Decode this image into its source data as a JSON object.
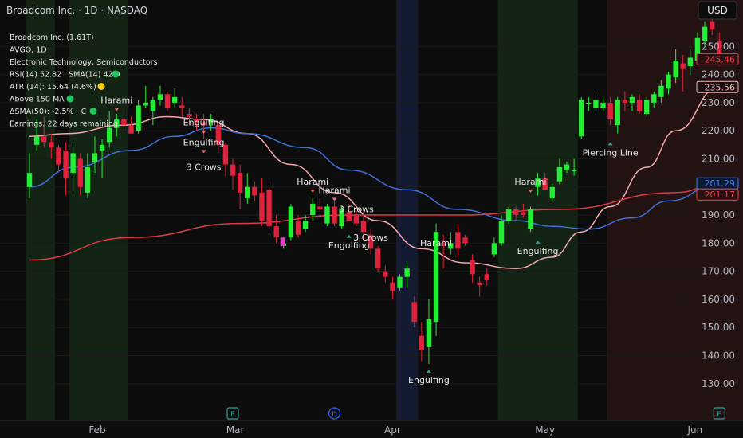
{
  "header": {
    "title": "Broadcom Inc. · 1D · NASDAQ",
    "currency": "USD"
  },
  "info_lines": [
    "Broadcom Inc. (1.61T)",
    "AVGO, 1D",
    "Electronic Technology, Semiconductors",
    "RSI(14) 52.82 · SMA(14) 42.9",
    "ATR (14): 15.64 (4.6%)",
    "Above 150 MA",
    "ΔSMA(50): -2.5% · C",
    "Earnings: 22 days remaining"
  ],
  "info_dots": [
    {
      "line": 3,
      "color": "#22c55e"
    },
    {
      "line": 4,
      "color": "#facc15"
    },
    {
      "line": 5,
      "color": "#22c55e"
    },
    {
      "line": 6,
      "color": "#22c55e"
    }
  ],
  "price_labels": [
    {
      "value": 245.46,
      "text": "245.46",
      "color": "#ef4444",
      "fill": "#2a0e12"
    },
    {
      "value": 235.56,
      "text": "235.56",
      "color": "#f4b6b6",
      "fill": "#1a1212"
    },
    {
      "value": 201.29,
      "text": "201.29",
      "color": "#3b82f6",
      "fill": "#0c1a33"
    },
    {
      "value": 201.17,
      "text": "201.17",
      "color": "#ef4444",
      "fill": "#2a0e12"
    }
  ],
  "event_markers": [
    {
      "date": "2025-02-28",
      "letter": "E",
      "color": "#26a69a"
    },
    {
      "date": "2025-03-20",
      "letter": "D",
      "color": "#2962ff"
    },
    {
      "date": "2025-06-05",
      "letter": "E",
      "color": "#26a69a"
    }
  ],
  "chart_data": {
    "type": "candlestick",
    "y_ticks": [
      130,
      140,
      150,
      160,
      170,
      180,
      190,
      200,
      210,
      220,
      230,
      240,
      250
    ],
    "ylim": [
      122,
      262
    ],
    "x_labels": [
      {
        "date": "2025-02-01",
        "text": "Feb"
      },
      {
        "date": "2025-03-01",
        "text": "Mar"
      },
      {
        "date": "2025-04-01",
        "text": "Apr"
      },
      {
        "date": "2025-05-01",
        "text": "May"
      },
      {
        "date": "2025-06-01",
        "text": "Jun"
      }
    ],
    "shaded_regions": [
      {
        "from": "2025-01-17",
        "to": "2025-01-18",
        "color": "#142414"
      },
      {
        "from": "2025-01-21",
        "to": "2025-01-23",
        "color": "#142414"
      },
      {
        "from": "2025-01-28",
        "to": "2025-01-31",
        "color": "#142414"
      },
      {
        "from": "2025-02-03",
        "to": "2025-02-06",
        "color": "#142414"
      },
      {
        "from": "2025-04-02",
        "to": "2025-04-04",
        "color": "#151a33"
      },
      {
        "from": "2025-04-23",
        "to": "2025-05-07",
        "color": "#142414"
      },
      {
        "from": "2025-05-14",
        "to": "2025-05-28",
        "color": "#231313"
      },
      {
        "from": "2025-05-29",
        "to": "2025-06-09",
        "color": "#231313"
      }
    ],
    "candles": [
      {
        "d": "2025-01-17",
        "o": 200,
        "h": 212,
        "l": 196,
        "c": 205
      },
      {
        "d": "2025-01-21",
        "o": 215,
        "h": 224,
        "l": 213,
        "c": 218
      },
      {
        "d": "2025-01-22",
        "o": 218,
        "h": 225,
        "l": 214,
        "c": 216
      },
      {
        "d": "2025-01-23",
        "o": 216,
        "h": 219,
        "l": 210,
        "c": 214
      },
      {
        "d": "2025-01-24",
        "o": 214,
        "h": 215,
        "l": 205,
        "c": 208
      },
      {
        "d": "2025-01-27",
        "o": 213,
        "h": 216,
        "l": 197,
        "c": 203
      },
      {
        "d": "2025-01-28",
        "o": 205,
        "h": 215,
        "l": 198,
        "c": 212
      },
      {
        "d": "2025-01-29",
        "o": 210,
        "h": 212,
        "l": 197,
        "c": 200
      },
      {
        "d": "2025-01-30",
        "o": 198,
        "h": 212,
        "l": 196,
        "c": 207
      },
      {
        "d": "2025-01-31",
        "o": 209,
        "h": 218,
        "l": 205,
        "c": 212
      },
      {
        "d": "2025-02-03",
        "o": 213,
        "h": 217,
        "l": 203,
        "c": 215
      },
      {
        "d": "2025-02-04",
        "o": 216,
        "h": 227,
        "l": 214,
        "c": 221
      },
      {
        "d": "2025-02-05",
        "o": 221,
        "h": 226,
        "l": 218,
        "c": 224
      },
      {
        "d": "2025-02-06",
        "o": 224,
        "h": 228,
        "l": 220,
        "c": 222
      },
      {
        "d": "2025-02-07",
        "o": 222,
        "h": 225,
        "l": 219,
        "c": 219
      },
      {
        "d": "2025-02-10",
        "o": 220,
        "h": 231,
        "l": 219,
        "c": 229
      },
      {
        "d": "2025-02-11",
        "o": 229,
        "h": 236,
        "l": 228,
        "c": 230
      },
      {
        "d": "2025-02-12",
        "o": 227,
        "h": 232,
        "l": 222,
        "c": 231
      },
      {
        "d": "2025-02-13",
        "o": 231,
        "h": 236,
        "l": 229,
        "c": 233
      },
      {
        "d": "2025-02-14",
        "o": 233,
        "h": 234,
        "l": 227,
        "c": 228
      },
      {
        "d": "2025-02-18",
        "o": 230,
        "h": 235,
        "l": 228,
        "c": 232
      },
      {
        "d": "2025-02-19",
        "o": 229,
        "h": 232,
        "l": 225,
        "c": 228
      },
      {
        "d": "2025-02-20",
        "o": 226,
        "h": 228,
        "l": 222,
        "c": 225
      },
      {
        "d": "2025-02-21",
        "o": 224,
        "h": 226,
        "l": 220,
        "c": 223
      },
      {
        "d": "2025-02-24",
        "o": 223,
        "h": 226,
        "l": 217,
        "c": 222
      },
      {
        "d": "2025-02-25",
        "o": 223,
        "h": 226,
        "l": 220,
        "c": 224
      },
      {
        "d": "2025-02-26",
        "o": 222,
        "h": 223,
        "l": 212,
        "c": 215
      },
      {
        "d": "2025-02-27",
        "o": 215,
        "h": 216,
        "l": 204,
        "c": 208
      },
      {
        "d": "2025-02-28",
        "o": 208,
        "h": 210,
        "l": 199,
        "c": 204
      },
      {
        "d": "2025-03-03",
        "o": 205,
        "h": 208,
        "l": 192,
        "c": 198
      },
      {
        "d": "2025-03-04",
        "o": 196,
        "h": 205,
        "l": 194,
        "c": 200
      },
      {
        "d": "2025-03-05",
        "o": 200,
        "h": 202,
        "l": 195,
        "c": 197
      },
      {
        "d": "2025-03-06",
        "o": 198,
        "h": 203,
        "l": 186,
        "c": 188
      },
      {
        "d": "2025-03-07",
        "o": 199,
        "h": 202,
        "l": 183,
        "c": 186
      },
      {
        "d": "2025-03-10",
        "o": 186,
        "h": 190,
        "l": 180,
        "c": 182
      },
      {
        "d": "2025-03-11",
        "o": 179,
        "h": 182,
        "l": 178,
        "c": 180
      },
      {
        "d": "2025-03-12",
        "o": 182,
        "h": 194,
        "l": 181,
        "c": 193
      },
      {
        "d": "2025-03-13",
        "o": 188,
        "h": 190,
        "l": 182,
        "c": 183
      },
      {
        "d": "2025-03-14",
        "o": 185,
        "h": 190,
        "l": 184,
        "c": 188
      },
      {
        "d": "2025-03-17",
        "o": 190,
        "h": 196,
        "l": 188,
        "c": 194
      },
      {
        "d": "2025-03-18",
        "o": 193,
        "h": 196,
        "l": 191,
        "c": 192
      },
      {
        "d": "2025-03-19",
        "o": 187,
        "h": 194,
        "l": 186,
        "c": 193
      },
      {
        "d": "2025-03-20",
        "o": 193,
        "h": 195,
        "l": 186,
        "c": 187
      },
      {
        "d": "2025-03-21",
        "o": 186,
        "h": 193,
        "l": 185,
        "c": 192
      },
      {
        "d": "2025-03-24",
        "o": 191,
        "h": 194,
        "l": 188,
        "c": 188
      },
      {
        "d": "2025-03-25",
        "o": 190,
        "h": 192,
        "l": 186,
        "c": 187
      },
      {
        "d": "2025-03-26",
        "o": 188,
        "h": 191,
        "l": 181,
        "c": 184
      },
      {
        "d": "2025-03-27",
        "o": 183,
        "h": 185,
        "l": 176,
        "c": 178
      },
      {
        "d": "2025-03-28",
        "o": 178,
        "h": 179,
        "l": 170,
        "c": 171
      },
      {
        "d": "2025-03-31",
        "o": 170,
        "h": 172,
        "l": 166,
        "c": 168
      },
      {
        "d": "2025-04-01",
        "o": 166,
        "h": 168,
        "l": 160,
        "c": 163
      },
      {
        "d": "2025-04-02",
        "o": 164,
        "h": 169,
        "l": 163,
        "c": 168
      },
      {
        "d": "2025-04-03",
        "o": 168,
        "h": 173,
        "l": 164,
        "c": 171
      },
      {
        "d": "2025-04-04",
        "o": 159,
        "h": 161,
        "l": 150,
        "c": 152
      },
      {
        "d": "2025-04-07",
        "o": 147,
        "h": 152,
        "l": 138,
        "c": 142
      },
      {
        "d": "2025-04-08",
        "o": 143,
        "h": 160,
        "l": 137,
        "c": 153
      },
      {
        "d": "2025-04-09",
        "o": 152,
        "h": 187,
        "l": 147,
        "c": 184
      },
      {
        "d": "2025-04-10",
        "o": 180,
        "h": 183,
        "l": 171,
        "c": 179
      },
      {
        "d": "2025-04-11",
        "o": 178,
        "h": 184,
        "l": 176,
        "c": 180
      },
      {
        "d": "2025-04-14",
        "o": 184,
        "h": 187,
        "l": 175,
        "c": 178
      },
      {
        "d": "2025-04-15",
        "o": 182,
        "h": 183,
        "l": 179,
        "c": 180
      },
      {
        "d": "2025-04-16",
        "o": 174,
        "h": 176,
        "l": 166,
        "c": 169
      },
      {
        "d": "2025-04-17",
        "o": 166,
        "h": 168,
        "l": 161,
        "c": 165
      },
      {
        "d": "2025-04-21",
        "o": 169,
        "h": 171,
        "l": 165,
        "c": 167
      },
      {
        "d": "2025-04-22",
        "o": 176,
        "h": 182,
        "l": 175,
        "c": 180
      },
      {
        "d": "2025-04-23",
        "o": 180,
        "h": 190,
        "l": 179,
        "c": 188
      },
      {
        "d": "2025-04-24",
        "o": 188,
        "h": 193,
        "l": 187,
        "c": 192
      },
      {
        "d": "2025-04-25",
        "o": 192,
        "h": 193,
        "l": 188,
        "c": 190
      },
      {
        "d": "2025-04-28",
        "o": 191,
        "h": 194,
        "l": 189,
        "c": 190
      },
      {
        "d": "2025-04-29",
        "o": 185,
        "h": 193,
        "l": 184,
        "c": 192
      },
      {
        "d": "2025-04-30",
        "o": 200,
        "h": 205,
        "l": 197,
        "c": 203
      },
      {
        "d": "2025-05-01",
        "o": 203,
        "h": 205,
        "l": 199,
        "c": 199
      },
      {
        "d": "2025-05-02",
        "o": 196,
        "h": 201,
        "l": 195,
        "c": 200
      },
      {
        "d": "2025-05-05",
        "o": 202,
        "h": 210,
        "l": 201,
        "c": 207
      },
      {
        "d": "2025-05-06",
        "o": 206,
        "h": 209,
        "l": 205,
        "c": 208
      },
      {
        "d": "2025-05-07",
        "o": 206,
        "h": 210,
        "l": 204,
        "c": 206
      },
      {
        "d": "2025-05-08",
        "o": 218,
        "h": 232,
        "l": 217,
        "c": 231
      },
      {
        "d": "2025-05-09",
        "o": 230,
        "h": 232,
        "l": 227,
        "c": 230
      },
      {
        "d": "2025-05-12",
        "o": 228,
        "h": 233,
        "l": 227,
        "c": 231
      },
      {
        "d": "2025-05-13",
        "o": 228,
        "h": 232,
        "l": 227,
        "c": 230
      },
      {
        "d": "2025-05-14",
        "o": 230,
        "h": 232,
        "l": 222,
        "c": 224
      },
      {
        "d": "2025-05-15",
        "o": 222,
        "h": 232,
        "l": 219,
        "c": 231
      },
      {
        "d": "2025-05-16",
        "o": 231,
        "h": 234,
        "l": 227,
        "c": 230
      },
      {
        "d": "2025-05-19",
        "o": 230,
        "h": 233,
        "l": 227,
        "c": 232
      },
      {
        "d": "2025-05-20",
        "o": 231,
        "h": 233,
        "l": 226,
        "c": 227
      },
      {
        "d": "2025-05-21",
        "o": 226,
        "h": 232,
        "l": 225,
        "c": 231
      },
      {
        "d": "2025-05-22",
        "o": 230,
        "h": 234,
        "l": 228,
        "c": 233
      },
      {
        "d": "2025-05-23",
        "o": 232,
        "h": 238,
        "l": 230,
        "c": 236
      },
      {
        "d": "2025-05-27",
        "o": 235,
        "h": 241,
        "l": 233,
        "c": 240
      },
      {
        "d": "2025-05-28",
        "o": 239,
        "h": 249,
        "l": 237,
        "c": 245
      },
      {
        "d": "2025-05-29",
        "o": 244,
        "h": 247,
        "l": 234,
        "c": 242
      },
      {
        "d": "2025-05-30",
        "o": 243,
        "h": 249,
        "l": 240,
        "c": 246
      },
      {
        "d": "2025-06-02",
        "o": 245,
        "h": 255,
        "l": 244,
        "c": 253
      },
      {
        "d": "2025-06-03",
        "o": 252,
        "h": 259,
        "l": 250,
        "c": 257
      },
      {
        "d": "2025-06-04",
        "o": 259,
        "h": 262,
        "l": 254,
        "c": 256
      },
      {
        "d": "2025-06-05",
        "o": 252,
        "h": 255,
        "l": 243,
        "c": 246
      }
    ],
    "magenta_candle": {
      "d": "2025-03-12",
      "o": 181,
      "h": 182,
      "l": 179,
      "c": 180
    },
    "lines": [
      {
        "name": "SMA(20)",
        "color": "#f4a8a8",
        "points": [
          [
            "2025-01-17",
            218
          ],
          [
            "2025-01-27",
            219
          ],
          [
            "2025-02-06",
            222
          ],
          [
            "2025-02-14",
            225
          ],
          [
            "2025-02-24",
            224
          ],
          [
            "2025-03-04",
            219
          ],
          [
            "2025-03-12",
            208
          ],
          [
            "2025-03-20",
            198
          ],
          [
            "2025-03-28",
            188
          ],
          [
            "2025-04-07",
            178
          ],
          [
            "2025-04-15",
            173
          ],
          [
            "2025-04-25",
            171
          ],
          [
            "2025-05-02",
            175
          ],
          [
            "2025-05-08",
            184
          ],
          [
            "2025-05-14",
            193
          ],
          [
            "2025-05-21",
            207
          ],
          [
            "2025-05-28",
            220
          ],
          [
            "2025-06-05",
            235.56
          ]
        ]
      },
      {
        "name": "SMA(50)",
        "color": "#3f6fd8",
        "points": [
          [
            "2025-01-17",
            200
          ],
          [
            "2025-01-28",
            207
          ],
          [
            "2025-02-07",
            213
          ],
          [
            "2025-02-18",
            218
          ],
          [
            "2025-02-25",
            221
          ],
          [
            "2025-03-04",
            219
          ],
          [
            "2025-03-14",
            214
          ],
          [
            "2025-03-24",
            206
          ],
          [
            "2025-04-03",
            199
          ],
          [
            "2025-04-14",
            192
          ],
          [
            "2025-04-25",
            188
          ],
          [
            "2025-05-02",
            186
          ],
          [
            "2025-05-09",
            185
          ],
          [
            "2025-05-19",
            189
          ],
          [
            "2025-05-27",
            195
          ],
          [
            "2025-06-05",
            201.29
          ]
        ]
      },
      {
        "name": "SMA(200)",
        "color": "#dc3b46",
        "points": [
          [
            "2025-01-17",
            174
          ],
          [
            "2025-02-07",
            182
          ],
          [
            "2025-03-03",
            187
          ],
          [
            "2025-03-24",
            190
          ],
          [
            "2025-04-14",
            190
          ],
          [
            "2025-05-05",
            192
          ],
          [
            "2025-05-28",
            198
          ],
          [
            "2025-06-05",
            201.17
          ]
        ]
      }
    ],
    "annotations": [
      {
        "d": "2025-02-05",
        "y": 227,
        "text": "Harami",
        "pos": "above"
      },
      {
        "d": "2025-02-24",
        "y": 219,
        "text": "Engulfing",
        "pos": "above"
      },
      {
        "d": "2025-02-24",
        "y": 206,
        "text": "3 Crows",
        "pos": "text"
      },
      {
        "d": "2025-02-24",
        "y": 212,
        "text": "Engulfing",
        "pos": "above"
      },
      {
        "d": "2025-03-17",
        "y": 198,
        "text": "Harami",
        "pos": "above"
      },
      {
        "d": "2025-03-20",
        "y": 195,
        "text": "Harami",
        "pos": "above"
      },
      {
        "d": "2025-03-25",
        "y": 191,
        "text": "3 Crows",
        "pos": "text"
      },
      {
        "d": "2025-03-24",
        "y": 183,
        "text": "Engulfing",
        "pos": "below"
      },
      {
        "d": "2025-03-27",
        "y": 181,
        "text": "3 Crows",
        "pos": "text"
      },
      {
        "d": "2025-04-09",
        "y": 179,
        "text": "Harami",
        "pos": "text"
      },
      {
        "d": "2025-04-08",
        "y": 135,
        "text": "Engulfing",
        "pos": "below"
      },
      {
        "d": "2025-04-29",
        "y": 198,
        "text": "Harami",
        "pos": "above"
      },
      {
        "d": "2025-04-30",
        "y": 181,
        "text": "Engulfing",
        "pos": "below"
      },
      {
        "d": "2025-05-14",
        "y": 216,
        "text": "Piercing Line",
        "pos": "below"
      }
    ]
  }
}
